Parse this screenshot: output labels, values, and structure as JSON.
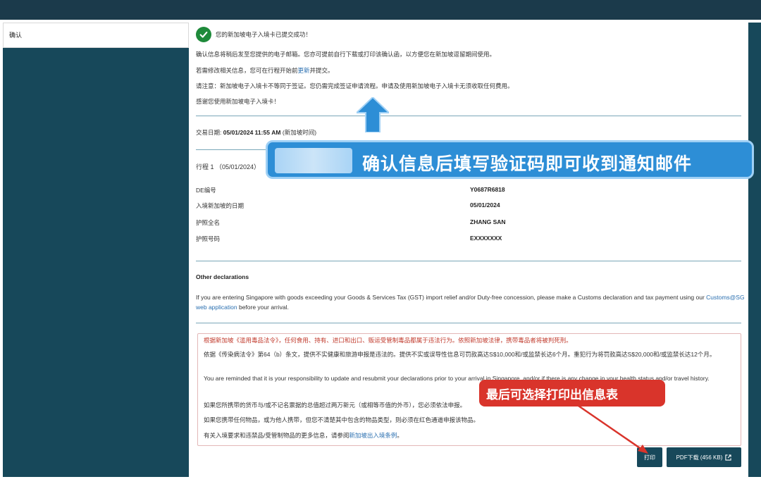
{
  "sidebar": {
    "items": [
      {
        "label": "确认"
      }
    ]
  },
  "success": {
    "message": "您的新加坡电子入境卡已提交成功！"
  },
  "info": {
    "line1": "确认信息将稍后发至您提供的电子邮箱。您亦可提前自行下载或打印该确认函，以方便您在新加坡逗留期间使用。",
    "line2_prefix": "若需修改相关信息，您可在行程开始前",
    "line2_link": "更新",
    "line2_suffix": "并提交。",
    "line3": "请注意：新加坡电子入境卡不等同于签证。您仍需完成签证申请流程。申请及使用新加坡电子入境卡无须收取任何费用。",
    "line4": "感谢您使用新加坡电子入境卡！"
  },
  "transaction": {
    "label": "交易日期:",
    "datetime": "05/01/2024 11:55 AM",
    "timezone": "(新加坡时间)"
  },
  "trip": {
    "label": "行程 1 （05/01/2024）"
  },
  "details": [
    {
      "key": "DE编号",
      "value": "Y0687R6818"
    },
    {
      "key": "入境新加坡的日期",
      "value": "05/01/2024"
    },
    {
      "key": "护照全名",
      "value": "ZHANG SAN"
    },
    {
      "key": "护照号码",
      "value": "EXXXXXXX"
    }
  ],
  "other_declarations": {
    "title": "Other declarations",
    "text_prefix": "If you are entering Singapore with goods exceeding your Goods & Services Tax (GST) import relief and/or Duty-free concession, please make a Customs declaration and tax payment using our ",
    "link": "Customs@SG web application",
    "text_suffix": " before your arrival."
  },
  "warnings": {
    "line1": "根据新加坡《滥用毒品法令》，任何食用、持有、进口和出口、贩运受管制毒品都属于违法行为。依照新加坡法律，携带毒品者将被判死刑。",
    "line2": "依据《传染病法令》第64（b）条文，提供不实健康和旅游申报是违法的。提供不实或误导性信息可罚款高达S$10,000和/或监禁长达6个月。重犯行为将罚款高达S$20,000和/或监禁长达12个月。",
    "line3": "You are reminded that it is your responsibility to update and resubmit your declarations prior to your arrival in Singapore, and/or if there is any change in your health status and/or travel history.",
    "line4": "如果您所携带的货币与/或不记名票据的总值超过两万新元（或相等币值的外币），您必须依法申报。",
    "line5": "如果您携带任何物品，或为他人携带，但您不清楚其中包含的物品类型，则必须在红色通道申报该物品。",
    "line6_prefix": "有关入境要求和违禁品/受管制物品的更多信息，请参阅",
    "line6_link": "新加坡出入境条例",
    "line6_suffix": "。"
  },
  "buttons": {
    "print": "打印",
    "pdf": "PDF下载 (456 KB)"
  },
  "annotations": {
    "callout_text": "确认信息后填写验证码即可收到通知邮件",
    "red_tag_text": "最后可选择打印出信息表"
  },
  "colors": {
    "header": "#1b3a4b",
    "sidebar": "#17485a",
    "callout": "#2d8ed6",
    "tag": "#d9342b",
    "success": "#1e8a3a"
  }
}
